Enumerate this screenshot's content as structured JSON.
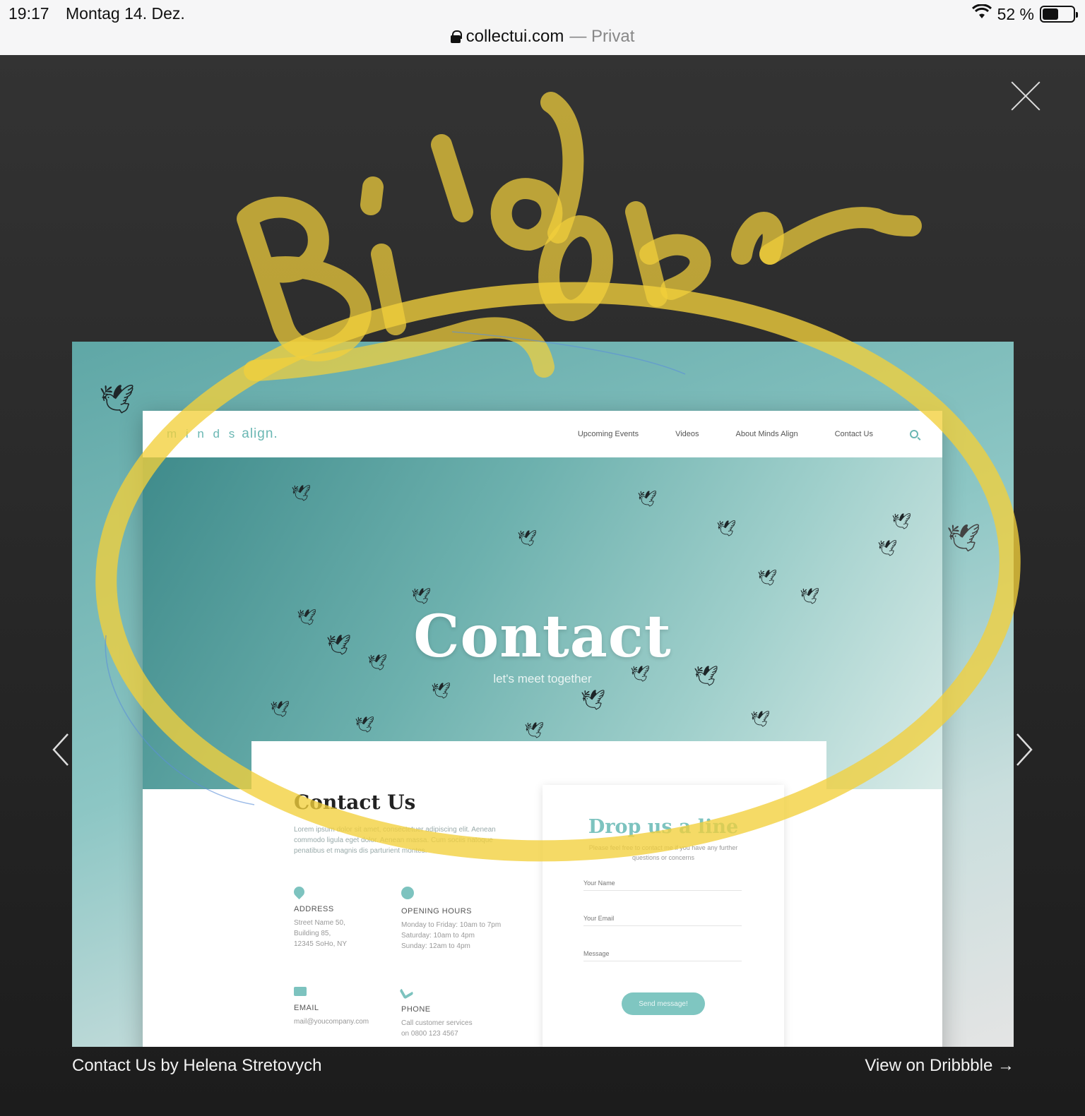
{
  "status_bar": {
    "time": "19:17",
    "date": "Montag 14. Dez.",
    "battery_percent": "52 %",
    "battery_level": 0.52
  },
  "address_bar": {
    "domain": "collectui.com",
    "mode": "— Privat"
  },
  "lightbox": {
    "caption": "Contact Us by Helena Stretovych",
    "dribbble_link": "View on Dribbble →",
    "annotation_text": "Bild oben"
  },
  "shot": {
    "logo": {
      "minds": "m i n d s",
      "align": "align."
    },
    "nav": [
      "Upcoming Events",
      "Videos",
      "About Minds Align",
      "Contact Us"
    ],
    "hero": {
      "title": "Contact",
      "subtitle": "let's meet together"
    },
    "contact": {
      "title": "Contact Us",
      "body": "Lorem ipsum dolor sit amet, consectetuer adipiscing elit. Aenean commodo ligula eget dolor. Aenean massa. Cum sociis natoque penatibus et magnis dis parturient montes.",
      "address": {
        "label": "ADDRESS",
        "lines": [
          "Street Name 50,",
          "Building 85,",
          "12345 SoHo, NY"
        ]
      },
      "hours": {
        "label": "OPENING HOURS",
        "lines": [
          "Monday to Friday: 10am to 7pm",
          "Saturday: 10am to 4pm",
          "Sunday: 12am to 4pm"
        ]
      },
      "email": {
        "label": "EMAIL",
        "lines": [
          "mail@youcompany.com"
        ]
      },
      "phone": {
        "label": "PHONE",
        "lines": [
          "Call customer services",
          "on 0800 123 4567"
        ]
      }
    },
    "form": {
      "title": "Drop us a line",
      "subtitle": "Please feel free to contact me if you have any further questions or concerns",
      "name_placeholder": "Your Name",
      "email_placeholder": "Your Email",
      "message_placeholder": "Message",
      "submit_label": "Send message!"
    }
  },
  "colors": {
    "accent_teal": "#7dc3bf",
    "annotation_yellow": "#f2d03b"
  }
}
